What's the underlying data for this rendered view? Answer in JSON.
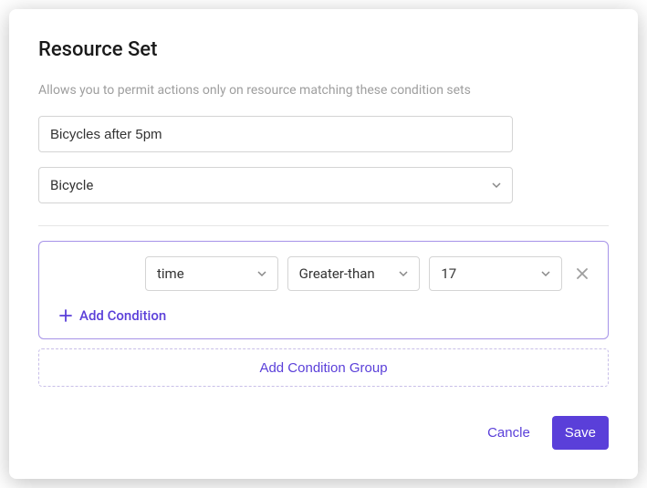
{
  "title": "Resource Set",
  "description": "Allows you to permit actions only on resource matching these condition sets",
  "name_value": "Bicycles after 5pm",
  "resource_value": "Bicycle",
  "condition_group": {
    "rows": [
      {
        "attribute": "time",
        "operator": "Greater-than",
        "value": "17"
      }
    ],
    "add_condition_label": "Add Condition"
  },
  "add_group_label": "Add Condition Group",
  "footer": {
    "cancel_label": "Cancle",
    "save_label": "Save"
  }
}
